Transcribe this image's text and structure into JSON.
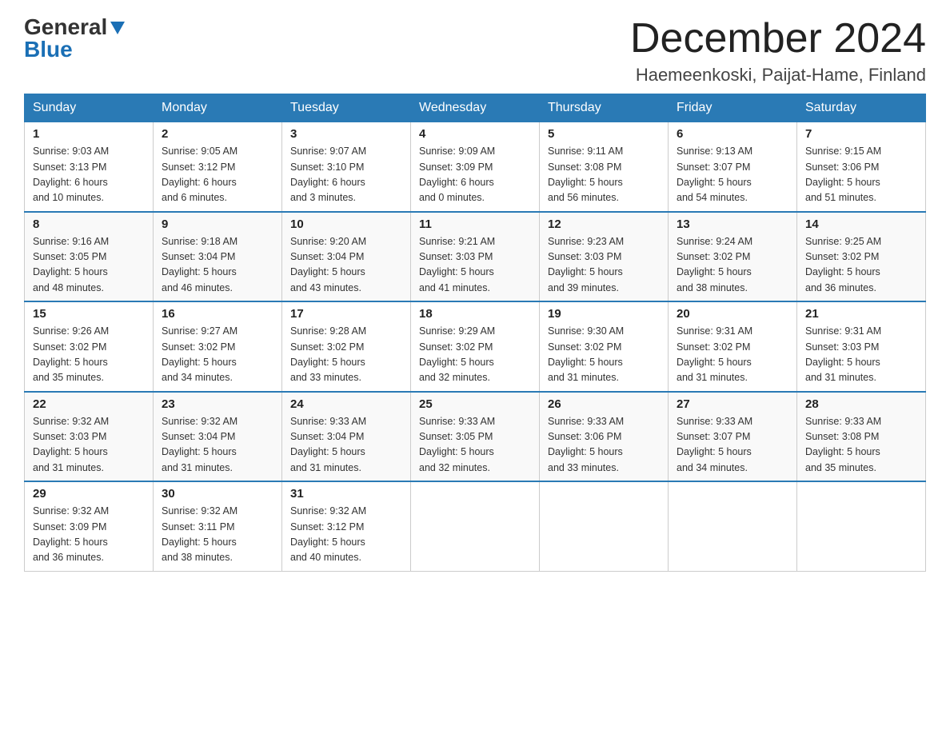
{
  "logo": {
    "general": "General",
    "blue": "Blue"
  },
  "title": "December 2024",
  "location": "Haemeenkoski, Paijat-Hame, Finland",
  "weekdays": [
    "Sunday",
    "Monday",
    "Tuesday",
    "Wednesday",
    "Thursday",
    "Friday",
    "Saturday"
  ],
  "weeks": [
    [
      {
        "day": "1",
        "sunrise": "9:03 AM",
        "sunset": "3:13 PM",
        "daylight": "6 hours",
        "daylight2": "and 10 minutes."
      },
      {
        "day": "2",
        "sunrise": "9:05 AM",
        "sunset": "3:12 PM",
        "daylight": "6 hours",
        "daylight2": "and 6 minutes."
      },
      {
        "day": "3",
        "sunrise": "9:07 AM",
        "sunset": "3:10 PM",
        "daylight": "6 hours",
        "daylight2": "and 3 minutes."
      },
      {
        "day": "4",
        "sunrise": "9:09 AM",
        "sunset": "3:09 PM",
        "daylight": "6 hours",
        "daylight2": "and 0 minutes."
      },
      {
        "day": "5",
        "sunrise": "9:11 AM",
        "sunset": "3:08 PM",
        "daylight": "5 hours",
        "daylight2": "and 56 minutes."
      },
      {
        "day": "6",
        "sunrise": "9:13 AM",
        "sunset": "3:07 PM",
        "daylight": "5 hours",
        "daylight2": "and 54 minutes."
      },
      {
        "day": "7",
        "sunrise": "9:15 AM",
        "sunset": "3:06 PM",
        "daylight": "5 hours",
        "daylight2": "and 51 minutes."
      }
    ],
    [
      {
        "day": "8",
        "sunrise": "9:16 AM",
        "sunset": "3:05 PM",
        "daylight": "5 hours",
        "daylight2": "and 48 minutes."
      },
      {
        "day": "9",
        "sunrise": "9:18 AM",
        "sunset": "3:04 PM",
        "daylight": "5 hours",
        "daylight2": "and 46 minutes."
      },
      {
        "day": "10",
        "sunrise": "9:20 AM",
        "sunset": "3:04 PM",
        "daylight": "5 hours",
        "daylight2": "and 43 minutes."
      },
      {
        "day": "11",
        "sunrise": "9:21 AM",
        "sunset": "3:03 PM",
        "daylight": "5 hours",
        "daylight2": "and 41 minutes."
      },
      {
        "day": "12",
        "sunrise": "9:23 AM",
        "sunset": "3:03 PM",
        "daylight": "5 hours",
        "daylight2": "and 39 minutes."
      },
      {
        "day": "13",
        "sunrise": "9:24 AM",
        "sunset": "3:02 PM",
        "daylight": "5 hours",
        "daylight2": "and 38 minutes."
      },
      {
        "day": "14",
        "sunrise": "9:25 AM",
        "sunset": "3:02 PM",
        "daylight": "5 hours",
        "daylight2": "and 36 minutes."
      }
    ],
    [
      {
        "day": "15",
        "sunrise": "9:26 AM",
        "sunset": "3:02 PM",
        "daylight": "5 hours",
        "daylight2": "and 35 minutes."
      },
      {
        "day": "16",
        "sunrise": "9:27 AM",
        "sunset": "3:02 PM",
        "daylight": "5 hours",
        "daylight2": "and 34 minutes."
      },
      {
        "day": "17",
        "sunrise": "9:28 AM",
        "sunset": "3:02 PM",
        "daylight": "5 hours",
        "daylight2": "and 33 minutes."
      },
      {
        "day": "18",
        "sunrise": "9:29 AM",
        "sunset": "3:02 PM",
        "daylight": "5 hours",
        "daylight2": "and 32 minutes."
      },
      {
        "day": "19",
        "sunrise": "9:30 AM",
        "sunset": "3:02 PM",
        "daylight": "5 hours",
        "daylight2": "and 31 minutes."
      },
      {
        "day": "20",
        "sunrise": "9:31 AM",
        "sunset": "3:02 PM",
        "daylight": "5 hours",
        "daylight2": "and 31 minutes."
      },
      {
        "day": "21",
        "sunrise": "9:31 AM",
        "sunset": "3:03 PM",
        "daylight": "5 hours",
        "daylight2": "and 31 minutes."
      }
    ],
    [
      {
        "day": "22",
        "sunrise": "9:32 AM",
        "sunset": "3:03 PM",
        "daylight": "5 hours",
        "daylight2": "and 31 minutes."
      },
      {
        "day": "23",
        "sunrise": "9:32 AM",
        "sunset": "3:04 PM",
        "daylight": "5 hours",
        "daylight2": "and 31 minutes."
      },
      {
        "day": "24",
        "sunrise": "9:33 AM",
        "sunset": "3:04 PM",
        "daylight": "5 hours",
        "daylight2": "and 31 minutes."
      },
      {
        "day": "25",
        "sunrise": "9:33 AM",
        "sunset": "3:05 PM",
        "daylight": "5 hours",
        "daylight2": "and 32 minutes."
      },
      {
        "day": "26",
        "sunrise": "9:33 AM",
        "sunset": "3:06 PM",
        "daylight": "5 hours",
        "daylight2": "and 33 minutes."
      },
      {
        "day": "27",
        "sunrise": "9:33 AM",
        "sunset": "3:07 PM",
        "daylight": "5 hours",
        "daylight2": "and 34 minutes."
      },
      {
        "day": "28",
        "sunrise": "9:33 AM",
        "sunset": "3:08 PM",
        "daylight": "5 hours",
        "daylight2": "and 35 minutes."
      }
    ],
    [
      {
        "day": "29",
        "sunrise": "9:32 AM",
        "sunset": "3:09 PM",
        "daylight": "5 hours",
        "daylight2": "and 36 minutes."
      },
      {
        "day": "30",
        "sunrise": "9:32 AM",
        "sunset": "3:11 PM",
        "daylight": "5 hours",
        "daylight2": "and 38 minutes."
      },
      {
        "day": "31",
        "sunrise": "9:32 AM",
        "sunset": "3:12 PM",
        "daylight": "5 hours",
        "daylight2": "and 40 minutes."
      },
      null,
      null,
      null,
      null
    ]
  ],
  "labels": {
    "sunrise": "Sunrise:",
    "sunset": "Sunset:",
    "daylight": "Daylight:"
  }
}
